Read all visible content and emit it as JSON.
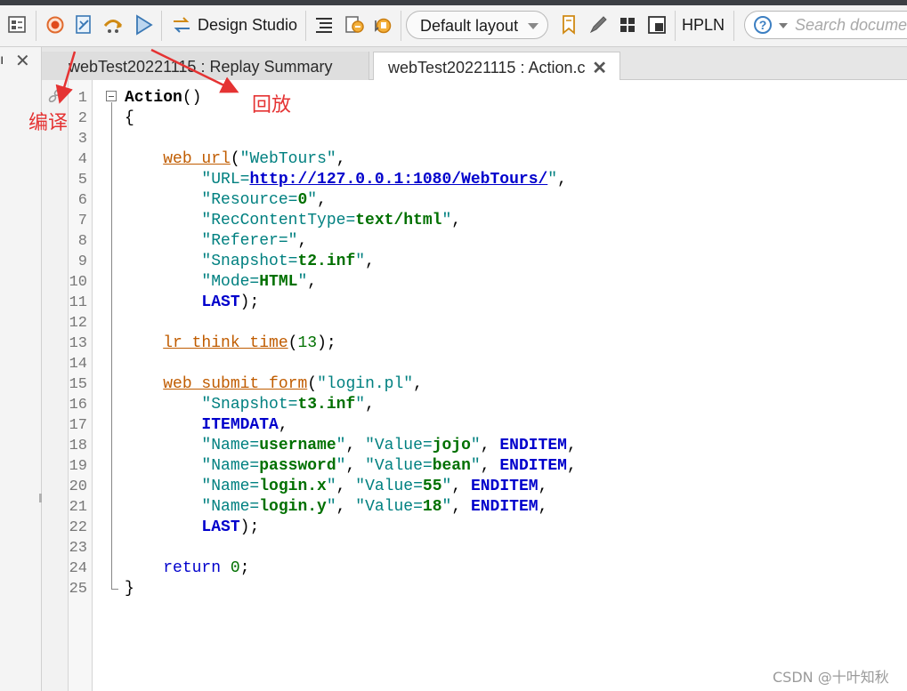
{
  "toolbar": {
    "design_studio_label": "Design Studio",
    "layout_selected": "Default layout",
    "hpln_label": "HPLN",
    "search_placeholder": "Search documentation",
    "icons": [
      "runtime-settings-icon",
      "record-icon",
      "compile-icon",
      "replay-step-icon",
      "replay-icon",
      "design-studio-icon",
      "align-icon",
      "breakpoint-icon",
      "cursor-step-icon",
      "bookmark-icon",
      "pen-icon",
      "grid-icon",
      "window-icon",
      "help-icon"
    ]
  },
  "left_panel": {
    "stub_text": "ı",
    "close_label": "✕"
  },
  "tabs": [
    {
      "label": "webTest20221115 : Replay Summary",
      "active": false
    },
    {
      "label": "webTest20221115 : Action.c",
      "active": true,
      "close_label": "✕"
    }
  ],
  "code": {
    "lines": [
      [
        {
          "t": "Action",
          "c": "bold"
        },
        {
          "t": "()",
          "c": ""
        }
      ],
      [
        {
          "t": "{",
          "c": ""
        }
      ],
      [],
      [
        {
          "t": "    ",
          "c": ""
        },
        {
          "t": "web_url",
          "c": "fn"
        },
        {
          "t": "(",
          "c": ""
        },
        {
          "t": "\"WebTours\"",
          "c": "str"
        },
        {
          "t": ",",
          "c": ""
        }
      ],
      [
        {
          "t": "        ",
          "c": ""
        },
        {
          "t": "\"URL=",
          "c": "str"
        },
        {
          "t": "http://127.0.0.1:1080/WebTours/",
          "c": "url"
        },
        {
          "t": "\"",
          "c": "str"
        },
        {
          "t": ",",
          "c": ""
        }
      ],
      [
        {
          "t": "        ",
          "c": ""
        },
        {
          "t": "\"Resource=",
          "c": "str"
        },
        {
          "t": "0",
          "c": "val"
        },
        {
          "t": "\"",
          "c": "str"
        },
        {
          "t": ",",
          "c": ""
        }
      ],
      [
        {
          "t": "        ",
          "c": ""
        },
        {
          "t": "\"RecContentType=",
          "c": "str"
        },
        {
          "t": "text/html",
          "c": "val"
        },
        {
          "t": "\"",
          "c": "str"
        },
        {
          "t": ",",
          "c": ""
        }
      ],
      [
        {
          "t": "        ",
          "c": ""
        },
        {
          "t": "\"Referer=\"",
          "c": "str"
        },
        {
          "t": ",",
          "c": ""
        }
      ],
      [
        {
          "t": "        ",
          "c": ""
        },
        {
          "t": "\"Snapshot=",
          "c": "str"
        },
        {
          "t": "t2.inf",
          "c": "val"
        },
        {
          "t": "\"",
          "c": "str"
        },
        {
          "t": ",",
          "c": ""
        }
      ],
      [
        {
          "t": "        ",
          "c": ""
        },
        {
          "t": "\"Mode=",
          "c": "str"
        },
        {
          "t": "HTML",
          "c": "val"
        },
        {
          "t": "\"",
          "c": "str"
        },
        {
          "t": ",",
          "c": ""
        }
      ],
      [
        {
          "t": "        ",
          "c": ""
        },
        {
          "t": "LAST",
          "c": "cst"
        },
        {
          "t": ");",
          "c": ""
        }
      ],
      [],
      [
        {
          "t": "    ",
          "c": ""
        },
        {
          "t": "lr_think_time",
          "c": "fn"
        },
        {
          "t": "(",
          "c": ""
        },
        {
          "t": "13",
          "c": "num"
        },
        {
          "t": ");",
          "c": ""
        }
      ],
      [],
      [
        {
          "t": "    ",
          "c": ""
        },
        {
          "t": "web_submit_form",
          "c": "fn"
        },
        {
          "t": "(",
          "c": ""
        },
        {
          "t": "\"login.pl\"",
          "c": "str"
        },
        {
          "t": ",",
          "c": ""
        }
      ],
      [
        {
          "t": "        ",
          "c": ""
        },
        {
          "t": "\"Snapshot=",
          "c": "str"
        },
        {
          "t": "t3.inf",
          "c": "val"
        },
        {
          "t": "\"",
          "c": "str"
        },
        {
          "t": ",",
          "c": ""
        }
      ],
      [
        {
          "t": "        ",
          "c": ""
        },
        {
          "t": "ITEMDATA",
          "c": "cst"
        },
        {
          "t": ",",
          "c": ""
        }
      ],
      [
        {
          "t": "        ",
          "c": ""
        },
        {
          "t": "\"Name=",
          "c": "str"
        },
        {
          "t": "username",
          "c": "val"
        },
        {
          "t": "\"",
          "c": "str"
        },
        {
          "t": ", ",
          "c": ""
        },
        {
          "t": "\"Value=",
          "c": "str"
        },
        {
          "t": "jojo",
          "c": "val"
        },
        {
          "t": "\"",
          "c": "str"
        },
        {
          "t": ", ",
          "c": ""
        },
        {
          "t": "ENDITEM",
          "c": "cst"
        },
        {
          "t": ",",
          "c": ""
        }
      ],
      [
        {
          "t": "        ",
          "c": ""
        },
        {
          "t": "\"Name=",
          "c": "str"
        },
        {
          "t": "password",
          "c": "val"
        },
        {
          "t": "\"",
          "c": "str"
        },
        {
          "t": ", ",
          "c": ""
        },
        {
          "t": "\"Value=",
          "c": "str"
        },
        {
          "t": "bean",
          "c": "val"
        },
        {
          "t": "\"",
          "c": "str"
        },
        {
          "t": ", ",
          "c": ""
        },
        {
          "t": "ENDITEM",
          "c": "cst"
        },
        {
          "t": ",",
          "c": ""
        }
      ],
      [
        {
          "t": "        ",
          "c": ""
        },
        {
          "t": "\"Name=",
          "c": "str"
        },
        {
          "t": "login.x",
          "c": "val"
        },
        {
          "t": "\"",
          "c": "str"
        },
        {
          "t": ", ",
          "c": ""
        },
        {
          "t": "\"Value=",
          "c": "str"
        },
        {
          "t": "55",
          "c": "val"
        },
        {
          "t": "\"",
          "c": "str"
        },
        {
          "t": ", ",
          "c": ""
        },
        {
          "t": "ENDITEM",
          "c": "cst"
        },
        {
          "t": ",",
          "c": ""
        }
      ],
      [
        {
          "t": "        ",
          "c": ""
        },
        {
          "t": "\"Name=",
          "c": "str"
        },
        {
          "t": "login.y",
          "c": "val"
        },
        {
          "t": "\"",
          "c": "str"
        },
        {
          "t": ", ",
          "c": ""
        },
        {
          "t": "\"Value=",
          "c": "str"
        },
        {
          "t": "18",
          "c": "val"
        },
        {
          "t": "\"",
          "c": "str"
        },
        {
          "t": ", ",
          "c": ""
        },
        {
          "t": "ENDITEM",
          "c": "cst"
        },
        {
          "t": ",",
          "c": ""
        }
      ],
      [
        {
          "t": "        ",
          "c": ""
        },
        {
          "t": "LAST",
          "c": "cst"
        },
        {
          "t": ");",
          "c": ""
        }
      ],
      [],
      [
        {
          "t": "    ",
          "c": ""
        },
        {
          "t": "return",
          "c": "kw"
        },
        {
          "t": " ",
          "c": ""
        },
        {
          "t": "0",
          "c": "num"
        },
        {
          "t": ";",
          "c": ""
        }
      ],
      [
        {
          "t": "}",
          "c": ""
        }
      ]
    ]
  },
  "annotations": {
    "compile_label": "编译",
    "replay_label": "回放",
    "color": "#e53333"
  },
  "watermark": "CSDN @十叶知秋"
}
